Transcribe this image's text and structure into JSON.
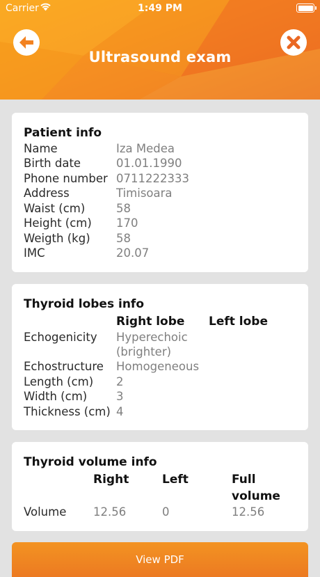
{
  "status_bar": {
    "carrier": "Carrier",
    "time": "1:49 PM"
  },
  "header": {
    "title": "Ultrasound exam",
    "back_icon": "arrow-left-icon",
    "close_icon": "close-x-icon",
    "accent_color": "#f28221"
  },
  "patient_info": {
    "heading": "Patient info",
    "rows": [
      {
        "label": "Name",
        "value": "Iza Medea"
      },
      {
        "label": "Birth date",
        "value": "01.01.1990"
      },
      {
        "label": "Phone number",
        "value": "0711222333"
      },
      {
        "label": "Address",
        "value": "Timisoara"
      },
      {
        "label": "Waist (cm)",
        "value": "58"
      },
      {
        "label": "Height (cm)",
        "value": "170"
      },
      {
        "label": "Weigth (kg)",
        "value": "58"
      },
      {
        "label": "IMC",
        "value": "20.07"
      }
    ]
  },
  "thyroid_lobes": {
    "heading": "Thyroid lobes info",
    "columns": [
      "Right lobe",
      "Left lobe"
    ],
    "rows": [
      {
        "label": "Echogenicity",
        "right": "Hyperechoic",
        "right_line2": "(brighter)",
        "left": ""
      },
      {
        "label": "Echostructure",
        "right": "Homogeneous",
        "left": ""
      },
      {
        "label": "Length (cm)",
        "right": "2",
        "left": ""
      },
      {
        "label": "Width (cm)",
        "right": "3",
        "left": ""
      },
      {
        "label": "Thickness (cm)",
        "right": "4",
        "left": ""
      }
    ]
  },
  "thyroid_volume": {
    "heading": "Thyroid volume info",
    "columns": [
      "Right",
      "Left",
      "Full",
      "volume"
    ],
    "row": {
      "label": "Volume",
      "right": "12.56",
      "left": "0",
      "full": "12.56"
    }
  },
  "actions": {
    "view_pdf": "View PDF"
  }
}
